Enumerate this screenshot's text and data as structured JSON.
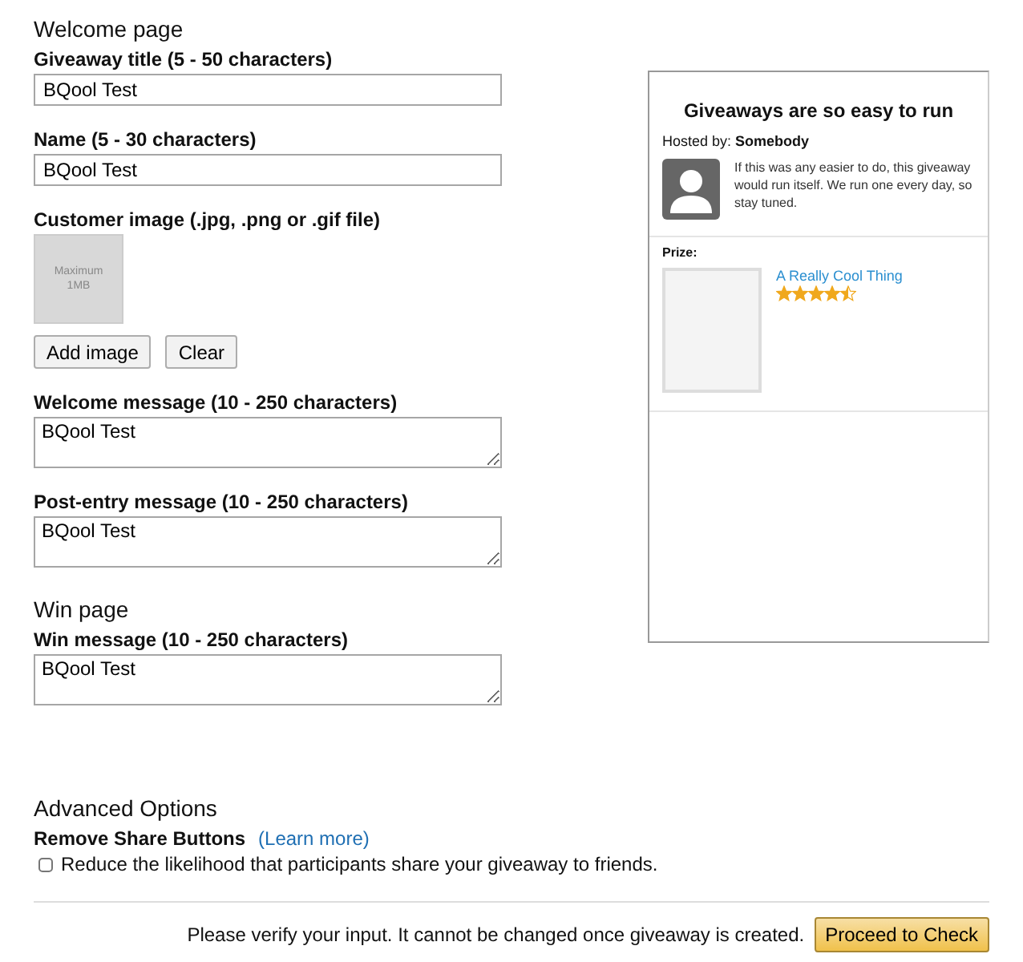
{
  "sections": [
    {
      "heading": "Welcome page",
      "fields": [
        {
          "kind": "input",
          "label": "Giveaway title (5 - 50 characters)",
          "value": "BQool Test"
        },
        {
          "kind": "input",
          "label": "Name (5 - 30 characters)",
          "value": "BQool Test"
        },
        {
          "kind": "image",
          "label": "Customer image (.jpg, .png or .gif file)",
          "placeholder_lines": [
            "Maximum",
            "1MB"
          ],
          "buttons": [
            "Add image",
            "Clear"
          ]
        },
        {
          "kind": "textarea",
          "label": "Welcome message (10 - 250 characters)",
          "value": "BQool Test"
        },
        {
          "kind": "textarea",
          "label": "Post-entry message (10 - 250 characters)",
          "value": "BQool Test"
        }
      ]
    },
    {
      "heading": "Win page",
      "fields": [
        {
          "kind": "textarea",
          "label": "Win message (10 - 250 characters)",
          "value": "BQool Test"
        }
      ]
    }
  ],
  "preview": {
    "title": "Giveaways are so easy to run",
    "hosted_label": "Hosted by:",
    "host": "Somebody",
    "message": "If this was any easier to do, this giveaway would run itself. We run one every day, so stay tuned.",
    "prize_label": "Prize:",
    "prize_name": "A Really Cool Thing",
    "stars": 4.5
  },
  "advanced": {
    "heading": "Advanced Options",
    "option_label": "Remove Share Buttons",
    "link": "(Learn more)",
    "checkbox_label": "Reduce the likelihood that participants share your giveaway to friends.",
    "checked": false
  },
  "footer": {
    "notice": "Please verify your input. It cannot be changed once giveaway is created.",
    "button": "Proceed to Check"
  }
}
